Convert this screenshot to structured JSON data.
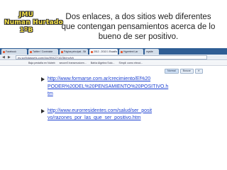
{
  "stamp": {
    "line1": "JMU",
    "line2": "Numan Hurtado",
    "line3": "1ºB"
  },
  "title": "Dos enlaces, a dos sitios web diferentes que contengan pensamientos acerca de lo bueno de ser positivo.",
  "browser": {
    "tabs": [
      {
        "label": "Facebook"
      },
      {
        "label": "Twitter / Conéctate"
      },
      {
        "label": "Página principal - Sit"
      },
      {
        "label": "2012 - 2013 1 Escaño"
      },
      {
        "label": "Hypertext Lar"
      },
      {
        "label": "mysite"
      }
    ],
    "back_glyph": "◀",
    "forward_glyph": "▶",
    "url": "es.scribdassets.com/doc/99427/16/3b/myfyh",
    "bookmarks": [
      {
        "label": "Baja pestaña en Nubeb"
      },
      {
        "label": "secure3 transmusicen..."
      },
      {
        "label": "Bahía Algebra Solo..."
      },
      {
        "label": "Simpli: como elecci..."
      }
    ],
    "toolbar": {
      "btn1": "Normal",
      "btn2": "Buscar",
      "btn3": "✕"
    }
  },
  "links": [
    {
      "line1": "http://www.formarse.com.ar/crecimiento/El%20",
      "line2": "PODER%20DEL%20PENSAMIENTO%20POSITIVO.h",
      "line3": "tm"
    },
    {
      "line1": "http://www.eurorresidentes.com/salud/ser_posit",
      "line2": "vo/razones_por_las_que_ser_positivo.htm",
      "line3": ""
    }
  ]
}
